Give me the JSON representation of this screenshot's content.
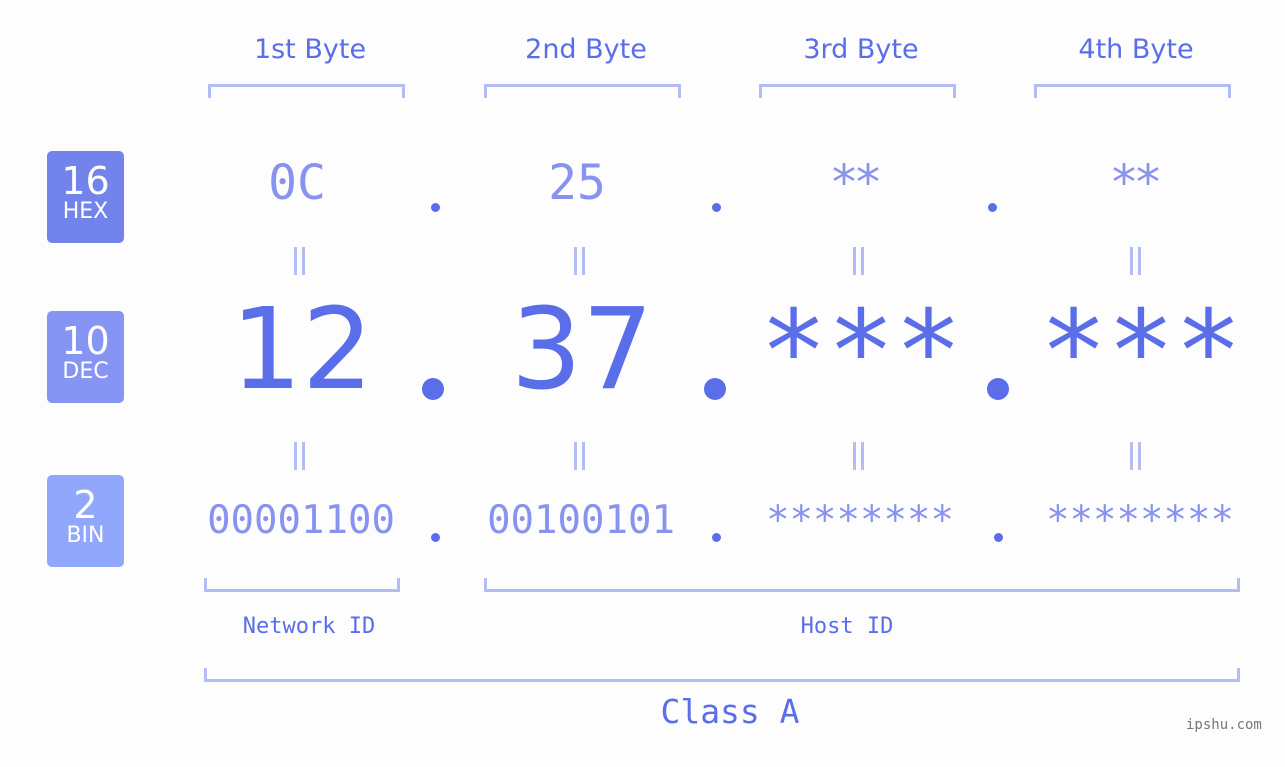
{
  "headers": {
    "bytes": [
      "1st Byte",
      "2nd Byte",
      "3rd Byte",
      "4th Byte"
    ]
  },
  "badges": {
    "hex": {
      "number": "16",
      "label": "HEX",
      "color": "#7383ec"
    },
    "dec": {
      "number": "10",
      "label": "DEC",
      "color": "#8695f4"
    },
    "bin": {
      "number": "2",
      "label": "BIN",
      "color": "#91a7fb"
    }
  },
  "ip": {
    "hex": [
      "0C",
      "25",
      "**",
      "**"
    ],
    "dec": [
      "12",
      "37",
      "***",
      "***"
    ],
    "bin": [
      "00001100",
      "00100101",
      "********",
      "********"
    ]
  },
  "segments": {
    "network_id": "Network ID",
    "host_id": "Host ID",
    "class": "Class A"
  },
  "watermark": "ipshu.com",
  "colors": {
    "primary": "#5a6ee9",
    "secondary": "#8793ee",
    "bracket": "#b3bcf5",
    "background": "#fcfdfc"
  }
}
